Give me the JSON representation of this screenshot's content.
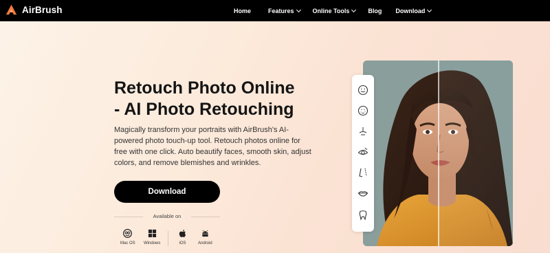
{
  "nav": {
    "brand": "AirBrush",
    "links": [
      {
        "label": "Home",
        "dropdown": false
      },
      {
        "label": "Features",
        "dropdown": true
      },
      {
        "label": "Online Tools",
        "dropdown": true
      },
      {
        "label": "Blog",
        "dropdown": false
      },
      {
        "label": "Download",
        "dropdown": true
      }
    ]
  },
  "hero": {
    "title_line1": "Retouch Photo Online",
    "title_line2": "- AI Photo Retouching",
    "description": "Magically transform your portraits with AirBrush's AI-powered photo touch-up tool. Retouch photos online for free with one click. Auto beautify faces, smooth skin, adjust colors, and remove blemishes and wrinkles.",
    "download_label": "Download",
    "available_label": "Available on",
    "platforms": [
      {
        "label": "Mac OS",
        "icon": "finder-icon"
      },
      {
        "label": "Windows",
        "icon": "windows-icon"
      },
      {
        "label": "iOS",
        "icon": "apple-icon"
      },
      {
        "label": "Android",
        "icon": "android-icon"
      }
    ]
  },
  "toolbar": {
    "tools": [
      "smile-face-icon",
      "blemish-face-icon",
      "nose-contour-icon",
      "eye-icon",
      "face-shape-icon",
      "lips-icon",
      "tooth-icon"
    ]
  },
  "colors": {
    "nav_bg": "#000000",
    "brand_orange": "#f47b3c",
    "button_bg": "#000000",
    "page_bg": "#fcebdc"
  }
}
